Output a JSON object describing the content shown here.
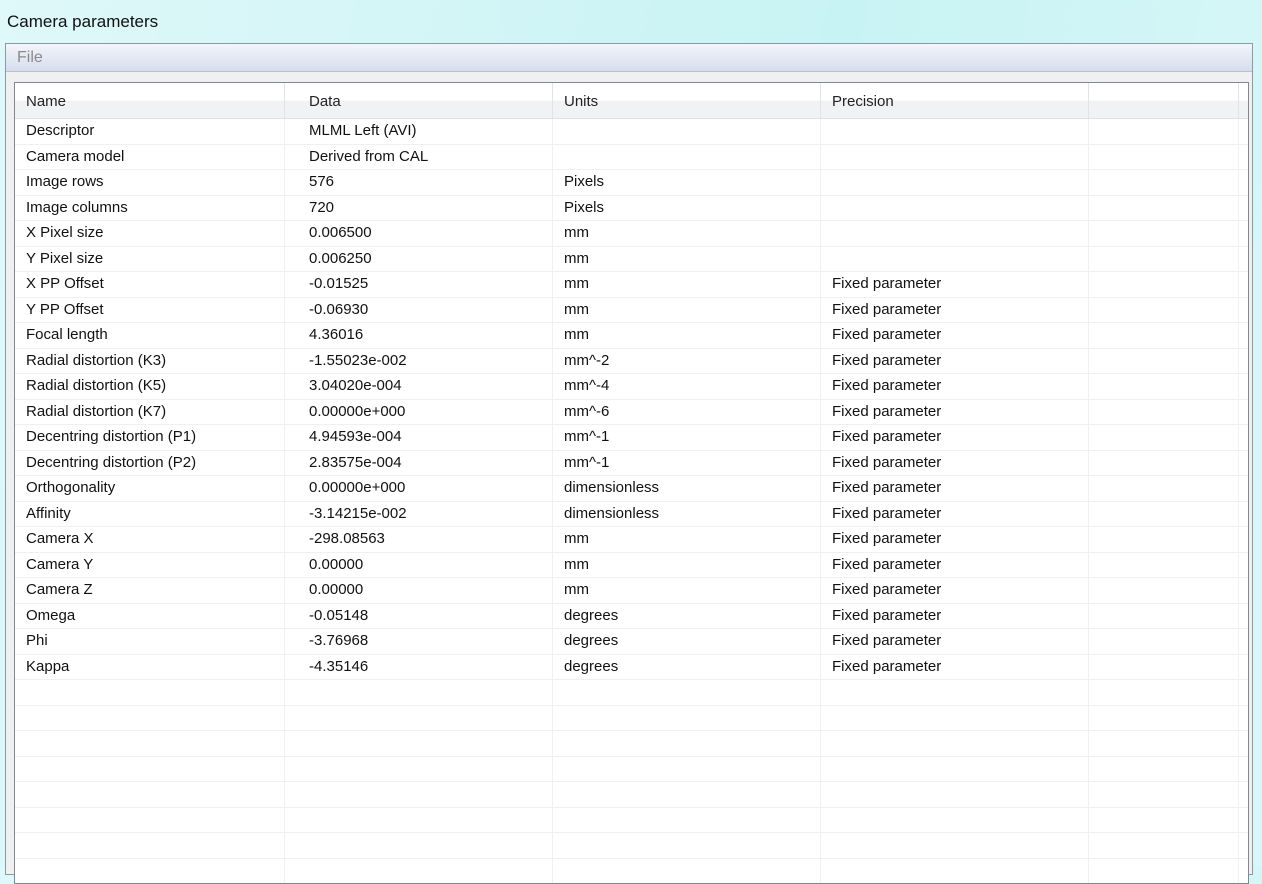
{
  "window": {
    "title": "Camera parameters"
  },
  "menu": [
    "File"
  ],
  "columns": [
    "Name",
    "Data",
    "Units",
    "Precision",
    ""
  ],
  "rows": [
    [
      "Descriptor",
      "MLML Left (AVI)",
      "",
      ""
    ],
    [
      "Camera model",
      "Derived from CAL",
      "",
      ""
    ],
    [
      "Image rows",
      "576",
      "Pixels",
      ""
    ],
    [
      "Image columns",
      "720",
      "Pixels",
      ""
    ],
    [
      "X Pixel size",
      "0.006500",
      "mm",
      ""
    ],
    [
      "Y Pixel size",
      "0.006250",
      "mm",
      ""
    ],
    [
      "X PP Offset",
      "-0.01525",
      "mm",
      "Fixed parameter"
    ],
    [
      "Y PP Offset",
      "-0.06930",
      "mm",
      "Fixed parameter"
    ],
    [
      "Focal length",
      "4.36016",
      "mm",
      "Fixed parameter"
    ],
    [
      "Radial distortion (K3)",
      "-1.55023e-002",
      "mm^-2",
      "Fixed parameter"
    ],
    [
      "Radial distortion (K5)",
      "3.04020e-004",
      "mm^-4",
      "Fixed parameter"
    ],
    [
      "Radial distortion (K7)",
      "0.00000e+000",
      "mm^-6",
      "Fixed parameter"
    ],
    [
      "Decentring distortion (P1)",
      "4.94593e-004",
      "mm^-1",
      "Fixed parameter"
    ],
    [
      "Decentring distortion (P2)",
      "2.83575e-004",
      "mm^-1",
      "Fixed parameter"
    ],
    [
      "Orthogonality",
      "0.00000e+000",
      "dimensionless",
      "Fixed parameter"
    ],
    [
      "Affinity",
      "-3.14215e-002",
      "dimensionless",
      "Fixed parameter"
    ],
    [
      "Camera X",
      "-298.08563",
      "mm",
      "Fixed parameter"
    ],
    [
      "Camera Y",
      "0.00000",
      "mm",
      "Fixed parameter"
    ],
    [
      "Camera Z",
      "0.00000",
      "mm",
      "Fixed parameter"
    ],
    [
      "Omega",
      "-0.05148",
      "degrees",
      "Fixed parameter"
    ],
    [
      "Phi",
      "-3.76968",
      "degrees",
      "Fixed parameter"
    ],
    [
      "Kappa",
      "-4.35146",
      "degrees",
      "Fixed parameter"
    ]
  ]
}
